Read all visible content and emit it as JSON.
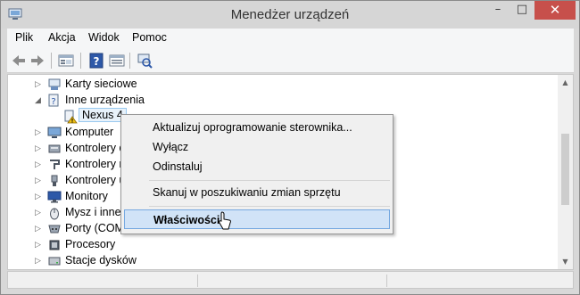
{
  "window": {
    "title": "Menedżer urządzeń",
    "buttons": {
      "minimize": "–",
      "maximize": "□",
      "close": "✕"
    }
  },
  "menu": [
    "Plik",
    "Akcja",
    "Widok",
    "Pomoc"
  ],
  "toolbar": [
    "back-arrow-icon",
    "forward-arrow-icon",
    "properties-icon",
    "help-icon",
    "view-icon",
    "scan-hardware-icon"
  ],
  "tree": [
    {
      "label": "Karty sieciowe",
      "icon": "network-adapter-icon",
      "expander": "collapsed"
    },
    {
      "label": "Inne urządzenia",
      "icon": "other-devices-icon",
      "expander": "expanded"
    },
    {
      "label": "Nexus 4",
      "icon": "warning-device-icon",
      "selected": true
    },
    {
      "label": "Komputer",
      "icon": "computer-icon",
      "expander": "collapsed"
    },
    {
      "label": "Kontrolery d",
      "icon": "disk-controller-icon",
      "expander": "collapsed"
    },
    {
      "label": "Kontrolery r",
      "icon": "controller-icon",
      "expander": "collapsed"
    },
    {
      "label": "Kontrolery u",
      "icon": "usb-controller-icon",
      "expander": "collapsed"
    },
    {
      "label": "Monitory",
      "icon": "monitor-icon",
      "expander": "collapsed"
    },
    {
      "label": "Mysz i inne",
      "icon": "mouse-icon",
      "expander": "collapsed"
    },
    {
      "label": "Porty (COM i LPT)",
      "icon": "port-icon",
      "expander": "collapsed"
    },
    {
      "label": "Procesory",
      "icon": "processor-icon",
      "expander": "collapsed"
    },
    {
      "label": "Stacje dysków",
      "icon": "disk-drive-icon",
      "expander": "collapsed"
    }
  ],
  "context_menu": {
    "items": [
      {
        "label": "Aktualizuj oprogramowanie sterownika..."
      },
      {
        "label": "Wyłącz"
      },
      {
        "label": "Odinstaluj"
      },
      {
        "label": "Skanuj w poszukiwaniu zmian sprzętu"
      },
      {
        "label": "Właściwości",
        "highlighted": true
      }
    ]
  },
  "colors": {
    "selection": "#e8f2fb",
    "menu_highlight": "#d1e3f7",
    "close_button": "#c7504b"
  }
}
